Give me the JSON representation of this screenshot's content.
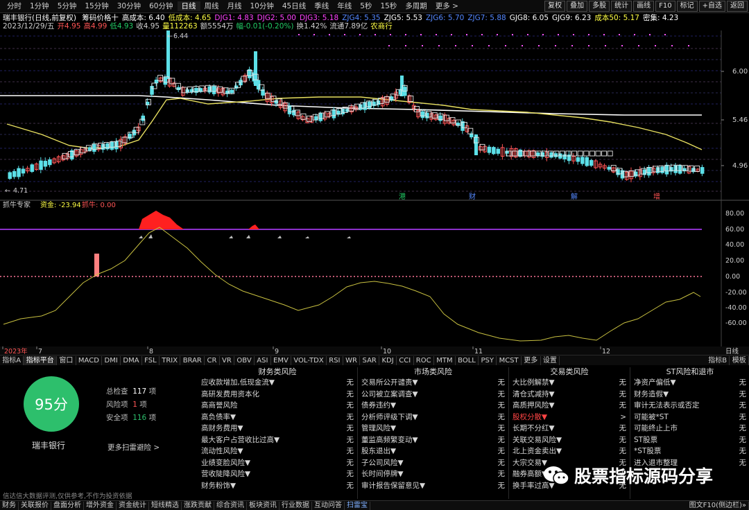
{
  "topbar": {
    "periods": [
      "分时",
      "1分钟",
      "5分钟",
      "15分钟",
      "30分钟",
      "60分钟",
      "日线",
      "周线",
      "月线",
      "10分钟",
      "45日线",
      "季线",
      "年线",
      "5秒",
      "15秒",
      "多周期",
      "更多 >"
    ],
    "active_period": "日线",
    "right_buttons": [
      "复权",
      "叠加",
      "多股",
      "统计",
      "画线",
      "F10",
      "标记",
      "+自选",
      "返回"
    ]
  },
  "info_line1": {
    "stock": "瑞丰银行(日线,前复权)",
    "items": [
      {
        "text": "筹码价格十",
        "color": "#ffffff"
      },
      {
        "text": "高成本: 6.40",
        "color": "#ffffff"
      },
      {
        "text": "低成本: 4.65",
        "color": "#ffff44"
      },
      {
        "text": "DJG1: 4.83",
        "color": "#ff44ff"
      },
      {
        "text": "DJG2: 5.00",
        "color": "#ff44ff"
      },
      {
        "text": "DJG3: 5.18",
        "color": "#ff44ff"
      },
      {
        "text": "ZJG4: 5.35",
        "color": "#5588ff"
      },
      {
        "text": "ZJG5: 5.53",
        "color": "#ffffff"
      },
      {
        "text": "ZJG6: 5.70",
        "color": "#5588ff"
      },
      {
        "text": "ZJG7: 5.88",
        "color": "#5588ff"
      },
      {
        "text": "GJG8: 6.05",
        "color": "#ffffff"
      },
      {
        "text": "GJG9: 6.23",
        "color": "#ffffff"
      },
      {
        "text": "成本50: 5.17",
        "color": "#ffff44"
      },
      {
        "text": "密集: 4.23",
        "color": "#ffffff"
      }
    ]
  },
  "info_line2": {
    "items": [
      {
        "text": "2023/12/29/五",
        "color": "#cfcfcf"
      },
      {
        "text": "开4.95",
        "color": "#ff5555"
      },
      {
        "text": "高4.99",
        "color": "#ff5555"
      },
      {
        "text": "低4.93",
        "color": "#22cc66"
      },
      {
        "text": "收4.95",
        "color": "#cfcfcf"
      },
      {
        "text": "量112263",
        "color": "#ffff44"
      },
      {
        "text": "额5554万",
        "color": "#cfcfcf"
      },
      {
        "text": "幅-0.01(-0.20%)",
        "color": "#22cc66"
      },
      {
        "text": "换1.42%",
        "color": "#cfcfcf"
      },
      {
        "text": "流通7.89亿",
        "color": "#cfcfcf"
      },
      {
        "text": "农商行",
        "color": "#ffff44"
      }
    ]
  },
  "price_axis": [
    "6.00",
    "5.46",
    "4.96"
  ],
  "price_annotations": {
    "high": "6.44",
    "low": "4.71"
  },
  "event_markers": [
    {
      "label": "港",
      "color": "#22cc66"
    },
    {
      "label": "财",
      "color": "#5588ff"
    },
    {
      "label": "解",
      "color": "#5588ff"
    },
    {
      "label": "增",
      "color": "#ff5555"
    }
  ],
  "indicator": {
    "name": "抓牛专家",
    "fields": [
      {
        "text": "资金: -23.94",
        "color": "#ffff44"
      },
      {
        "text": "抓牛: 0.00",
        "color": "#ff5555"
      }
    ],
    "axis": [
      "80.00",
      "60.00",
      "40.00",
      "20.00",
      "0.00",
      "-20.00",
      "-40.00",
      "-60.00"
    ]
  },
  "date_axis": {
    "labels": [
      "2023年",
      "7",
      "8",
      "9",
      "10",
      "11",
      "12"
    ],
    "period": "日线"
  },
  "indicator_tabs": [
    "指标A",
    "指标平台",
    "窗口",
    "MACD",
    "DMI",
    "DMA",
    "FSL",
    "TRIX",
    "BRAR",
    "CR",
    "VR",
    "OBV",
    "ASI",
    "EMV",
    "VOL-TDX",
    "RSI",
    "WR",
    "SAR",
    "KDJ",
    "CCI",
    "ROC",
    "MTM",
    "BOLL",
    "PSY",
    "MCST",
    "更多",
    "设置"
  ],
  "indicator_tabs_right": [
    "指标B",
    "模板"
  ],
  "risk": {
    "score": "95分",
    "stock_name": "瑞丰银行",
    "total_label": "总检查",
    "total_value": "117",
    "total_unit": "项",
    "risk_label": "风险项",
    "risk_value": "1",
    "risk_unit": "项",
    "safe_label": "安全项",
    "safe_value": "116",
    "safe_unit": "项",
    "more_link": "更多扫雷避险 >",
    "disclaimer": "信达信大数据评测,仅供参考,不作为投资依据",
    "columns": [
      {
        "title": "财务类风险",
        "rows": [
          [
            "应收款增加,低现金流▼",
            "无"
          ],
          [
            "高研发费用资本化",
            "无"
          ],
          [
            "高商誉风险",
            "无"
          ],
          [
            "高负债率▼",
            "无"
          ],
          [
            "高财务费用▼",
            "无"
          ],
          [
            "最大客户占营收比过高▼",
            "无"
          ],
          [
            "流动性风险▼",
            "无"
          ],
          [
            "业绩变脸风险▼",
            "无"
          ],
          [
            "营收陡降风险▼",
            "无"
          ],
          [
            "财务粉饰▼",
            "无"
          ]
        ]
      },
      {
        "title": "市场类风险",
        "rows": [
          [
            "交易所公开谴责▼",
            "无"
          ],
          [
            "公司被立案调查▼",
            "无"
          ],
          [
            "债券违约▼",
            "无"
          ],
          [
            "分析师评级下调▼",
            "无"
          ],
          [
            "管理风险▼",
            "无"
          ],
          [
            "董监高频繁变动▼",
            "无"
          ],
          [
            "股东退出▼",
            "无"
          ],
          [
            "子公司风险▼",
            "无"
          ],
          [
            "长时间停牌▼",
            "无"
          ],
          [
            "审计报告保留意见▼",
            "无"
          ]
        ]
      },
      {
        "title": "交易类风险",
        "rows": [
          [
            "大比例解禁▼",
            "无"
          ],
          [
            "清仓式减持▼",
            "无"
          ],
          [
            "高质押风险▼",
            "无"
          ],
          [
            "股权分散▼",
            ">"
          ],
          [
            "长期不分红▼",
            "无"
          ],
          [
            "关联交易风险▼",
            "无"
          ],
          [
            "北上资金卖出▼",
            "无"
          ],
          [
            "大宗交易▼",
            "无"
          ],
          [
            "融券高额▼",
            "无"
          ],
          [
            "换手率过高▼",
            "无"
          ]
        ]
      },
      {
        "title": "ST风险和退市",
        "rows": [
          [
            "净资产偏低▼",
            "无"
          ],
          [
            "财务造假▼",
            "无"
          ],
          [
            "审计无法表示或否定",
            "无"
          ],
          [
            "可能被*ST",
            "无"
          ],
          [
            "可能终止上市",
            "无"
          ],
          [
            "ST股票",
            "无"
          ],
          [
            "*ST股票",
            "无"
          ],
          [
            "进入退市整理",
            "无"
          ]
        ]
      }
    ],
    "highlight_color": "#ff4444",
    "score_color": "#2dbf6c"
  },
  "watermark": "股票指标源码分享",
  "bottom_tabs": [
    "财务",
    "关联报价",
    "盘面分析",
    "增外资金",
    "资金统计",
    "短线精选",
    "涨跌贡献",
    "综合资讯",
    "板块资讯",
    "行业数据",
    "互动问答",
    "扫雷宝"
  ],
  "bottom_active": "扫雷宝",
  "bottom_right": "图文F10(侧边栏)»",
  "colors": {
    "up": "#ff5555",
    "down": "#5ce0e8",
    "ma_yellow": "#e8e060",
    "ma_white": "#ffffff",
    "indicator_line": "#c8c040",
    "purple": "#8b2fc9"
  }
}
